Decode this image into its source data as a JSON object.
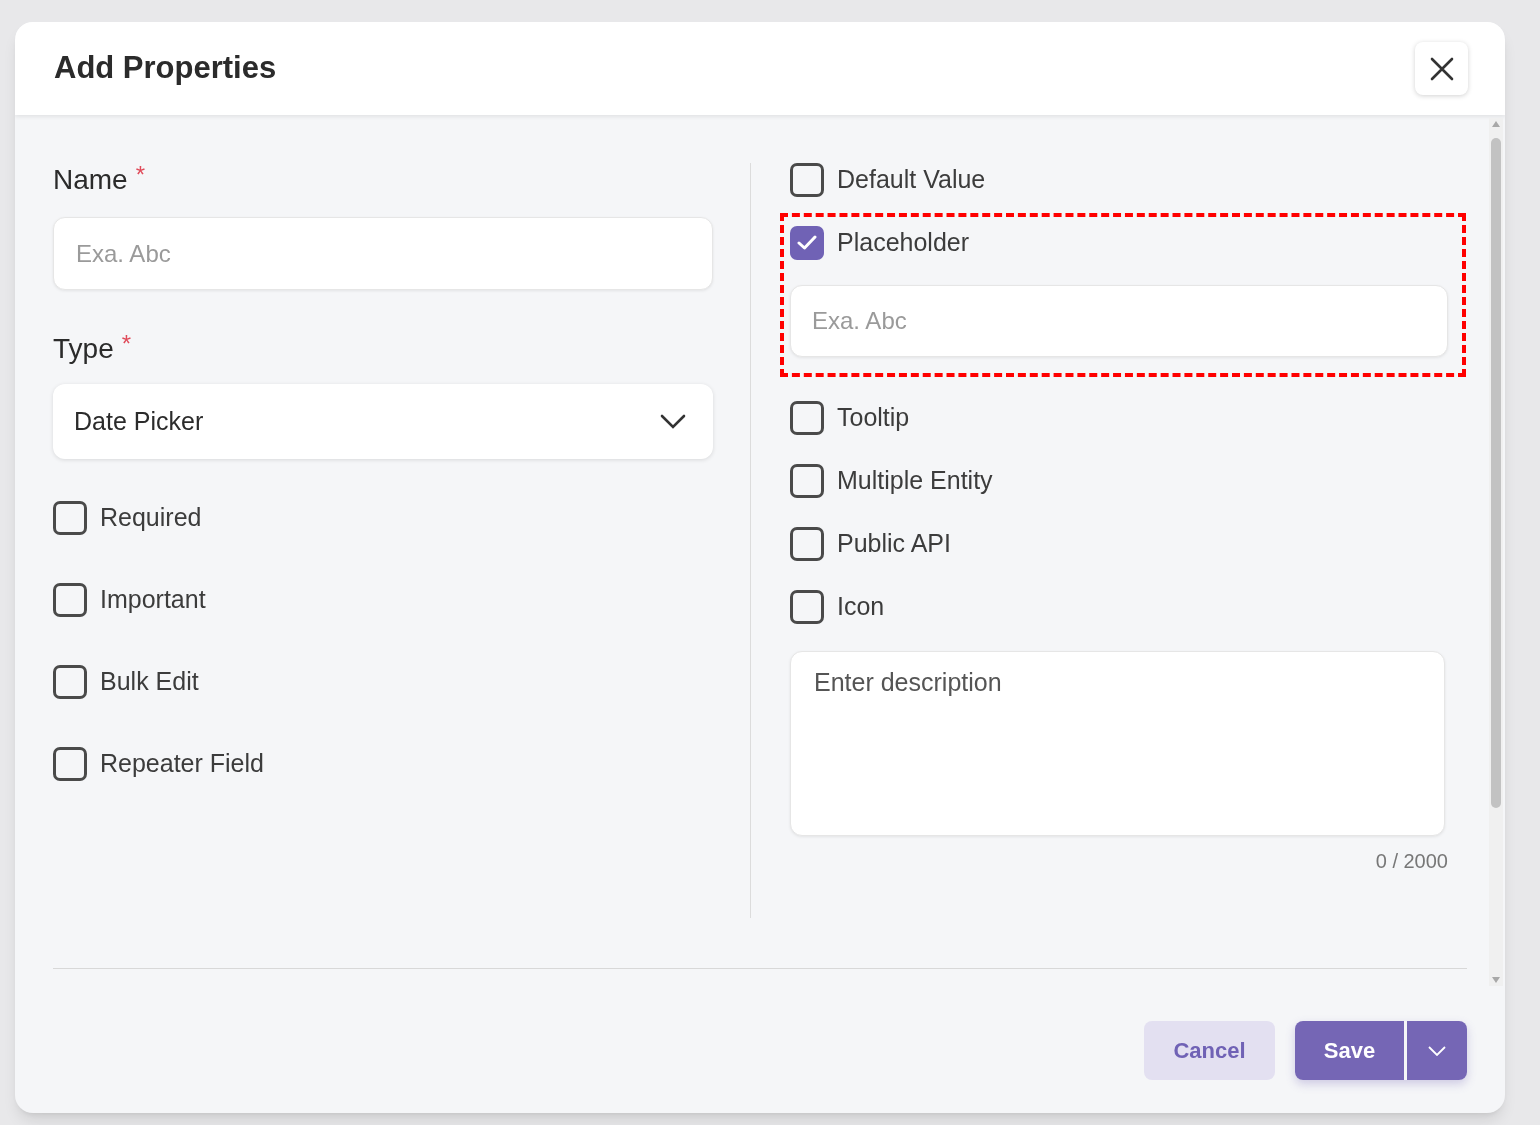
{
  "dialog": {
    "title": "Add Properties"
  },
  "name_field": {
    "label": "Name",
    "required_mark": "*",
    "placeholder": "Exa. Abc"
  },
  "type_field": {
    "label": "Type",
    "required_mark": "*",
    "value": "Date Picker"
  },
  "left_options": [
    {
      "label": "Required",
      "checked": false
    },
    {
      "label": "Important",
      "checked": false
    },
    {
      "label": "Bulk Edit",
      "checked": false
    },
    {
      "label": "Repeater Field",
      "checked": false
    }
  ],
  "right_options": [
    {
      "label": "Default Value",
      "checked": false,
      "highlighted": false
    },
    {
      "label": "Placeholder",
      "checked": true,
      "highlighted": true,
      "input_placeholder": "Exa. Abc"
    },
    {
      "label": "Tooltip",
      "checked": false,
      "highlighted": false
    },
    {
      "label": "Multiple Entity",
      "checked": false,
      "highlighted": false
    },
    {
      "label": "Public API",
      "checked": false,
      "highlighted": false
    },
    {
      "label": "Icon",
      "checked": false,
      "highlighted": false
    }
  ],
  "description": {
    "placeholder": "Enter description",
    "counter": "0 / 2000"
  },
  "buttons": {
    "cancel": "Cancel",
    "save": "Save"
  }
}
